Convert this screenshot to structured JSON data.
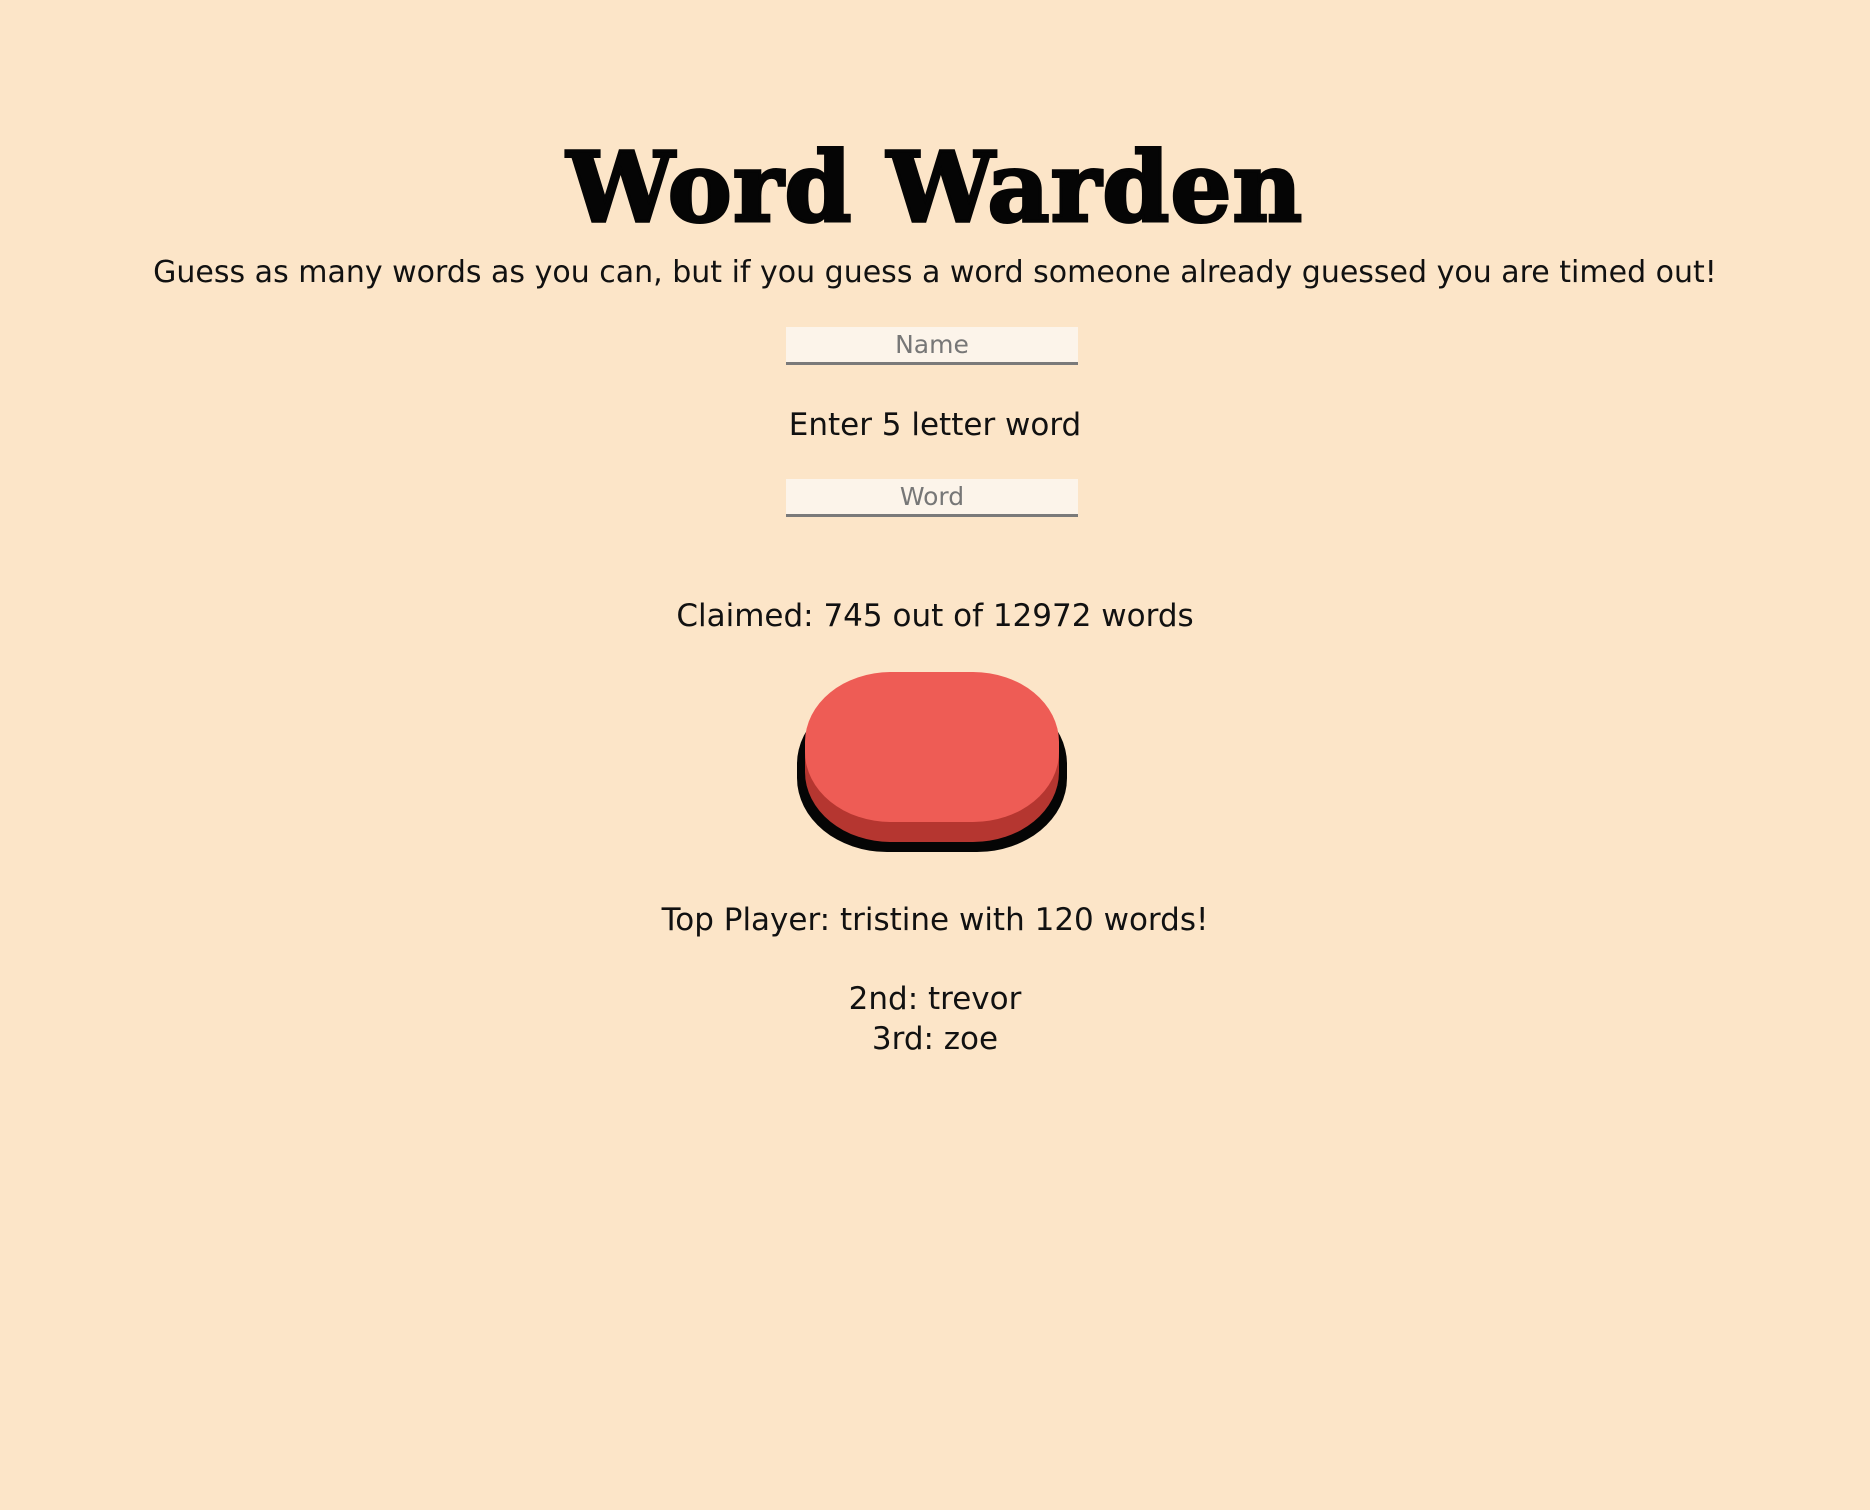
{
  "header": {
    "title": "Word Warden",
    "subtitle": "Guess as many words as you can, but if you guess a word someone already guessed you are timed out!"
  },
  "form": {
    "name_placeholder": "Name",
    "name_value": "",
    "word_prompt": "Enter 5 letter word",
    "word_placeholder": "Word",
    "word_value": ""
  },
  "stats": {
    "claimed_text": "Claimed: 745 out of 12972 words"
  },
  "leaderboard": {
    "top_player_text": "Top Player: tristine with 120 words!",
    "second_text": "2nd: trevor",
    "third_text": "3rd: zoe"
  },
  "colors": {
    "background": "#fce5c8",
    "button_cap": "#ee5c55",
    "button_base": "#b53630",
    "button_outline": "#050505",
    "input_background": "#fcf4ea"
  }
}
